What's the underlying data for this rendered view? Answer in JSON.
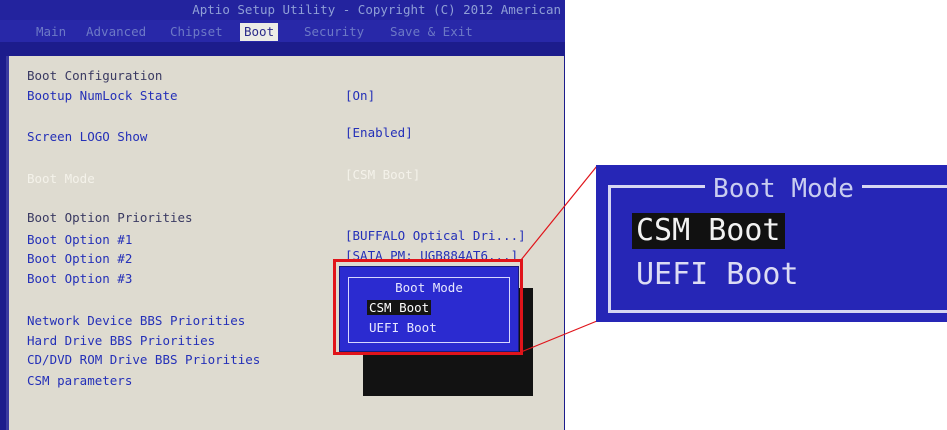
{
  "title_bar": "Aptio Setup Utility - Copyright (C) 2012 American",
  "tabs": [
    {
      "label": "Main"
    },
    {
      "label": "Advanced"
    },
    {
      "label": "Chipset"
    },
    {
      "label": "Boot"
    },
    {
      "label": "Security"
    },
    {
      "label": "Save & Exit"
    }
  ],
  "active_tab": "Boot",
  "boot": {
    "config_heading": "Boot Configuration",
    "numlock_label": "Bootup NumLock State",
    "numlock_value": "[On]",
    "logo_label": "Screen LOGO Show",
    "logo_value": "[Enabled]",
    "mode_label": "Boot Mode",
    "mode_value": "[CSM Boot]",
    "priorities_heading": "Boot Option Priorities",
    "option1_label": "Boot Option #1",
    "option1_value": "[BUFFALO Optical Dri...]",
    "option2_label": "Boot Option #2",
    "option2_value": "[SATA  PM: UGB884AT6...]",
    "option3_label": "Boot Option #3",
    "network_label": "Network Device BBS Priorities",
    "hdd_label": "Hard Drive BBS Priorities",
    "cddvd_label": "CD/DVD ROM Drive BBS Priorities",
    "csm_label": "CSM parameters"
  },
  "popup": {
    "title": "Boot Mode",
    "options": [
      "CSM Boot",
      "UEFI Boot"
    ],
    "selected": "CSM Boot"
  },
  "zoom": {
    "title": "Boot Mode",
    "options": [
      "CSM Boot",
      "UEFI Boot"
    ]
  },
  "colors": {
    "bios_blue": "#2b2bd0",
    "highlight_red": "#e0141a",
    "content_bg": "#dedbd0"
  }
}
